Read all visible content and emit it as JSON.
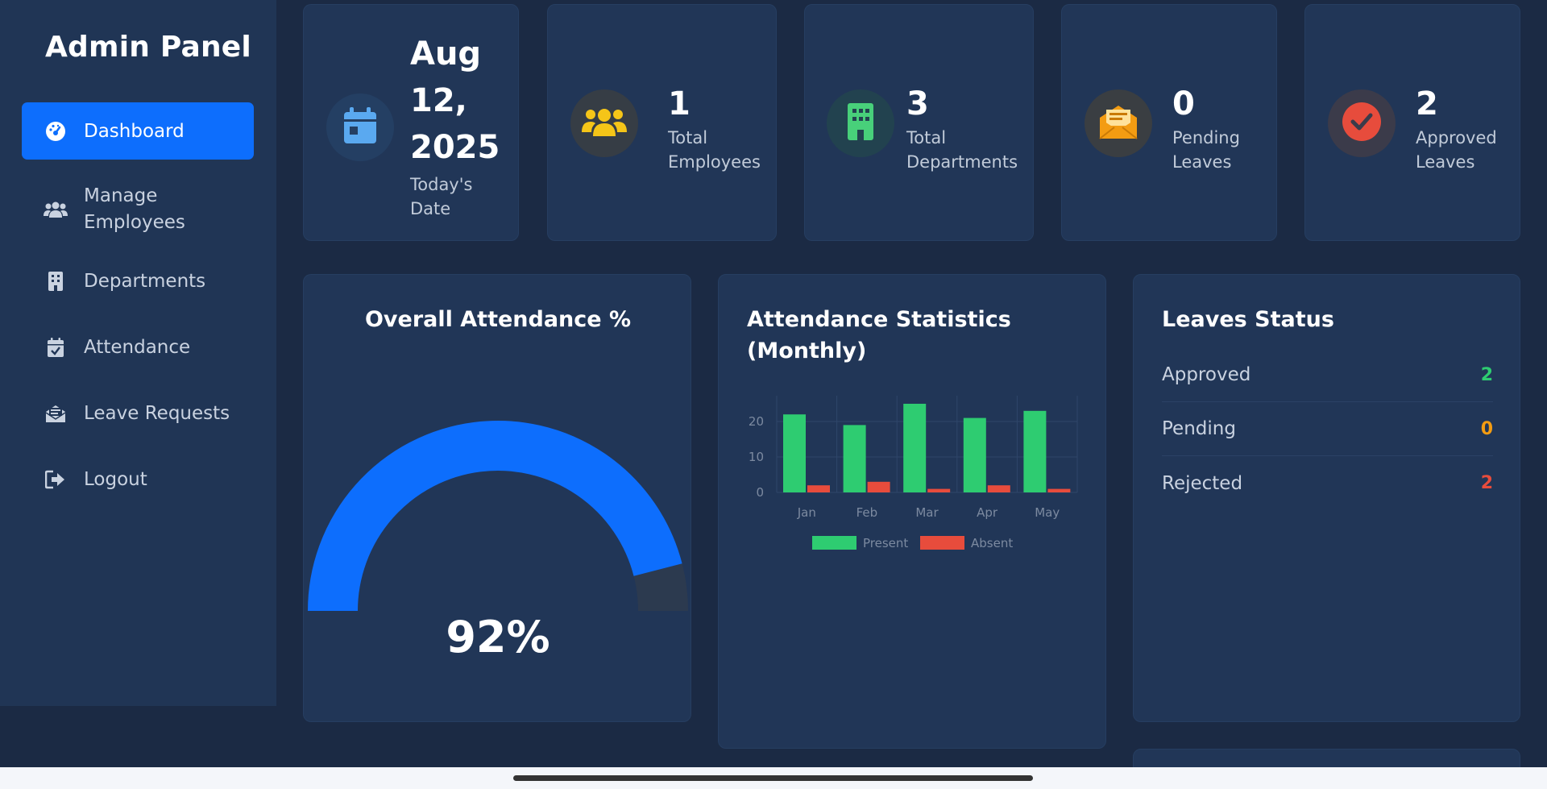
{
  "sidebar": {
    "title": "Admin Panel",
    "items": [
      {
        "label": "Dashboard",
        "icon": "dashboard-icon",
        "active": true
      },
      {
        "label": "Manage Employees",
        "icon": "users-icon"
      },
      {
        "label": "Departments",
        "icon": "building-icon"
      },
      {
        "label": "Attendance",
        "icon": "calendar-check-icon"
      },
      {
        "label": "Leave Requests",
        "icon": "envelope-icon"
      },
      {
        "label": "Logout",
        "icon": "logout-icon"
      }
    ]
  },
  "stats": [
    {
      "value": "Aug 12, 2025",
      "label": "Today's Date",
      "icon": "calendar-icon"
    },
    {
      "value": "1",
      "label": "Total Employees",
      "icon": "users-icon"
    },
    {
      "value": "3",
      "label": "Total Departments",
      "icon": "building-icon"
    },
    {
      "value": "0",
      "label": "Pending Leaves",
      "icon": "envelope-open-icon"
    },
    {
      "value": "2",
      "label": "Approved Leaves",
      "icon": "check-circle-icon"
    }
  ],
  "attendance_gauge": {
    "title": "Overall Attendance %",
    "value_text": "92%",
    "value": 92
  },
  "chart_data": {
    "type": "bar",
    "title": "Attendance Statistics (Monthly)",
    "categories": [
      "Jan",
      "Feb",
      "Mar",
      "Apr",
      "May"
    ],
    "series": [
      {
        "name": "Present",
        "values": [
          22,
          19,
          25,
          21,
          23
        ],
        "color": "#2ecc71"
      },
      {
        "name": "Absent",
        "values": [
          2,
          3,
          1,
          2,
          1
        ],
        "color": "#e74c3c"
      }
    ],
    "yticks": [
      "0",
      "10",
      "20"
    ],
    "ylim": [
      0,
      25
    ],
    "grid": true,
    "legend": "bottom"
  },
  "leaves_status": {
    "title": "Leaves Status",
    "rows": [
      {
        "label": "Approved",
        "value": "2",
        "color": "#2ecc71"
      },
      {
        "label": "Pending",
        "value": "0",
        "color": "#f39c12"
      },
      {
        "label": "Rejected",
        "value": "2",
        "color": "#e74c3c"
      }
    ]
  },
  "colors": {
    "accent": "#0d6efd",
    "background": "#1b2a44",
    "card": "#213657",
    "gauge_track": "#2c3a4f"
  }
}
